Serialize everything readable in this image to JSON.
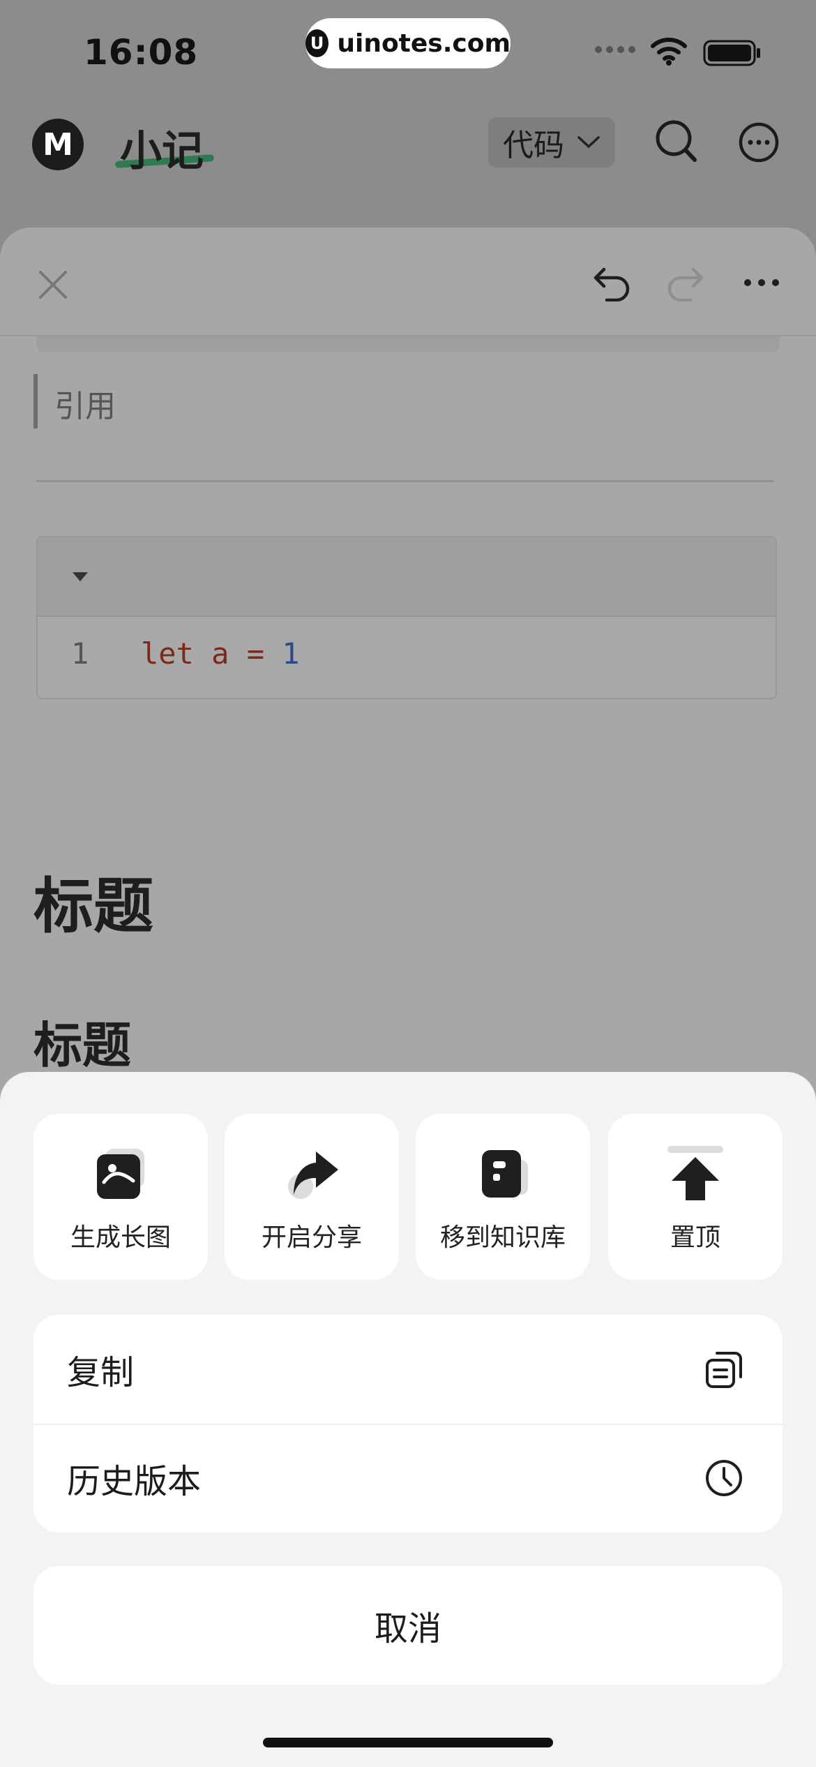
{
  "status_bar": {
    "time": "16:08",
    "site_logo": "U",
    "site_label": "uinotes.com"
  },
  "header": {
    "logo": "M",
    "title": "小记",
    "dropdown_label": "代码"
  },
  "editor": {
    "quote": "引用",
    "code": {
      "line_number": "1",
      "keyword": "let",
      "variable": "a",
      "operator": "=",
      "value": "1"
    },
    "heading1": "标题",
    "heading2": "标题"
  },
  "action_sheet": {
    "quick_actions": [
      {
        "label": "生成长图",
        "icon": "long-image-icon"
      },
      {
        "label": "开启分享",
        "icon": "share-icon"
      },
      {
        "label": "移到知识库",
        "icon": "knowledge-base-icon"
      },
      {
        "label": "置顶",
        "icon": "pin-top-icon"
      }
    ],
    "list": [
      {
        "label": "复制",
        "icon": "copy-icon"
      },
      {
        "label": "历史版本",
        "icon": "history-clock-icon"
      }
    ],
    "cancel": "取消"
  },
  "colors": {
    "overlay": "#8c8c8c",
    "sheet_background": "#f3f3f3",
    "card": "#ffffff",
    "accent_underline": "#2f7a52",
    "code_keyword": "#7a2a1a",
    "code_number": "#2a4a8a"
  }
}
